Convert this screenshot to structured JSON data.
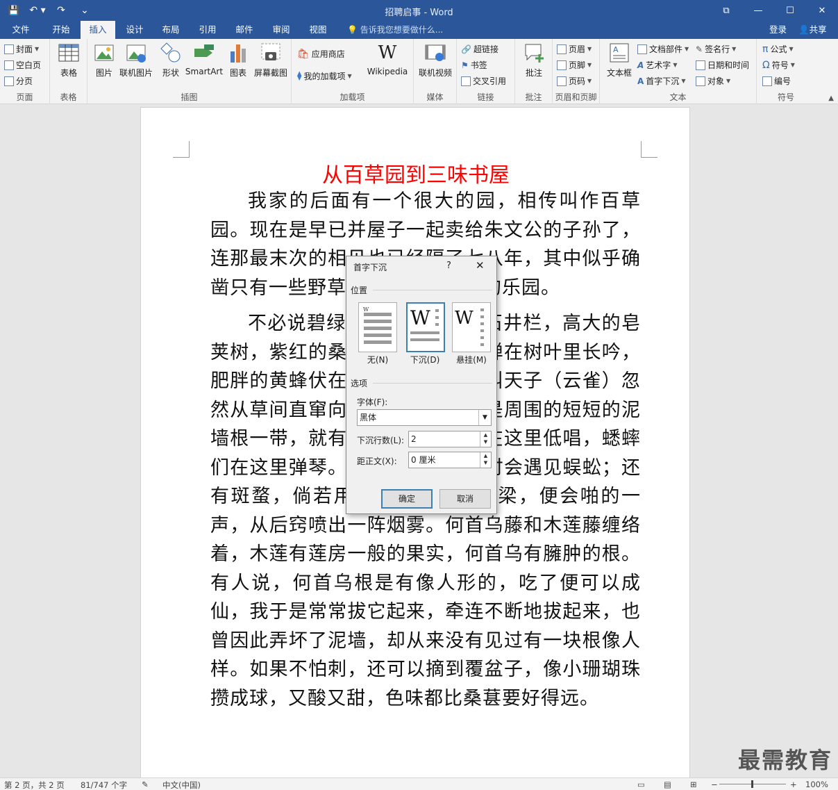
{
  "window": {
    "title": "招聘启事 - Word",
    "min": "—",
    "max": "☐",
    "close": "✕",
    "ribbon_opts": "⧉"
  },
  "qat": {
    "save": "💾",
    "undo": "↶ ▾",
    "redo": "↷",
    "customize": "⌄"
  },
  "tabs": [
    "文件",
    "开始",
    "插入",
    "设计",
    "布局",
    "引用",
    "邮件",
    "审阅",
    "视图"
  ],
  "active_tab": "插入",
  "tell_me": "告诉我您想要做什么...",
  "login": "登录",
  "share": "共享",
  "ribbon": {
    "pages": {
      "cover": "封面",
      "blank": "空白页",
      "break": "分页",
      "label": "页面"
    },
    "tables": {
      "table": "表格",
      "label": "表格"
    },
    "illustrations": {
      "picture": "图片",
      "online_picture": "联机图片",
      "shapes": "形状",
      "smartart": "SmartArt",
      "chart": "图表",
      "screenshot": "屏幕截图",
      "label": "插图"
    },
    "addins": {
      "store": "应用商店",
      "myaddins": "我的加载项",
      "wikipedia": "Wikipedia",
      "label": "加载项"
    },
    "media": {
      "online_video": "联机视频",
      "label": "媒体"
    },
    "links": {
      "hyperlink": "超链接",
      "bookmark": "书签",
      "crossref": "交叉引用",
      "label": "链接"
    },
    "comments": {
      "comment": "批注",
      "label": "批注"
    },
    "header_footer": {
      "header": "页眉",
      "footer": "页脚",
      "page_number": "页码",
      "label": "页眉和页脚"
    },
    "text": {
      "textbox": "文本框",
      "quickparts": "文档部件",
      "wordart": "艺术字",
      "dropcap": "首字下沉",
      "signature": "签名行",
      "datetime": "日期和时间",
      "object": "对象",
      "label": "文本"
    },
    "symbols": {
      "equation": "公式",
      "symbol": "符号",
      "numbering": "编号",
      "label": "符号"
    }
  },
  "document": {
    "title": "从百草园到三味书屋",
    "para1": "我家的后面有一个很大的园，相传叫作百草园。现在是早已并屋子一起卖给朱文公的子孙了，连那最末次的相见也已经隔了七八年，其中似乎确凿只有一些野草；但那时却是我的乐园。",
    "para2": "不必说碧绿的菜畦，光滑的石井栏，高大的皂荚树，紫红的桑葚；也不必说鸣蝉在树叶里长吟，肥胖的黄蜂伏在菜花上，轻捷的叫天子（云雀）忽然从草间直窜向云霄里去了。单是周围的短短的泥墙根一带，就有无限趣味。油蛉在这里低唱，蟋蟀们在这里弹琴。翻开断砖来，有时会遇见蜈蚣；还有斑蝥，倘若用手指按住它的脊梁，便会啪的一声，从后窍喷出一阵烟雾。何首乌藤和木莲藤缠络着，木莲有莲房一般的果实，何首乌有臃肿的根。有人说，何首乌根是有像人形的，吃了便可以成仙，我于是常常拔它起来，牵连不断地拔起来，也曾因此弄坏了泥墙，却从来没有见过有一块根像人样。如果不怕刺，还可以摘到覆盆子，像小珊瑚珠攒成球，又酸又甜，色味都比桑葚要好得远。"
  },
  "dialog": {
    "title": "首字下沉",
    "help": "?",
    "close": "✕",
    "position_label": "位置",
    "options": [
      "无(N)",
      "下沉(D)",
      "悬挂(M)"
    ],
    "selected": "下沉(D)",
    "options_label": "选项",
    "font_label": "字体(F):",
    "font_value": "黑体",
    "lines_label": "下沉行数(L):",
    "lines_value": "2",
    "distance_label": "距正文(X):",
    "distance_value": "0 厘米",
    "ok": "确定",
    "cancel": "取消"
  },
  "status": {
    "page": "第 2 页，共 2 页",
    "words": "81/747 个字",
    "language": "中文(中国)",
    "zoom": "100%"
  },
  "watermark": "最需教育",
  "colors": {
    "accent": "#2b579a",
    "title_red": "#ff0000"
  }
}
